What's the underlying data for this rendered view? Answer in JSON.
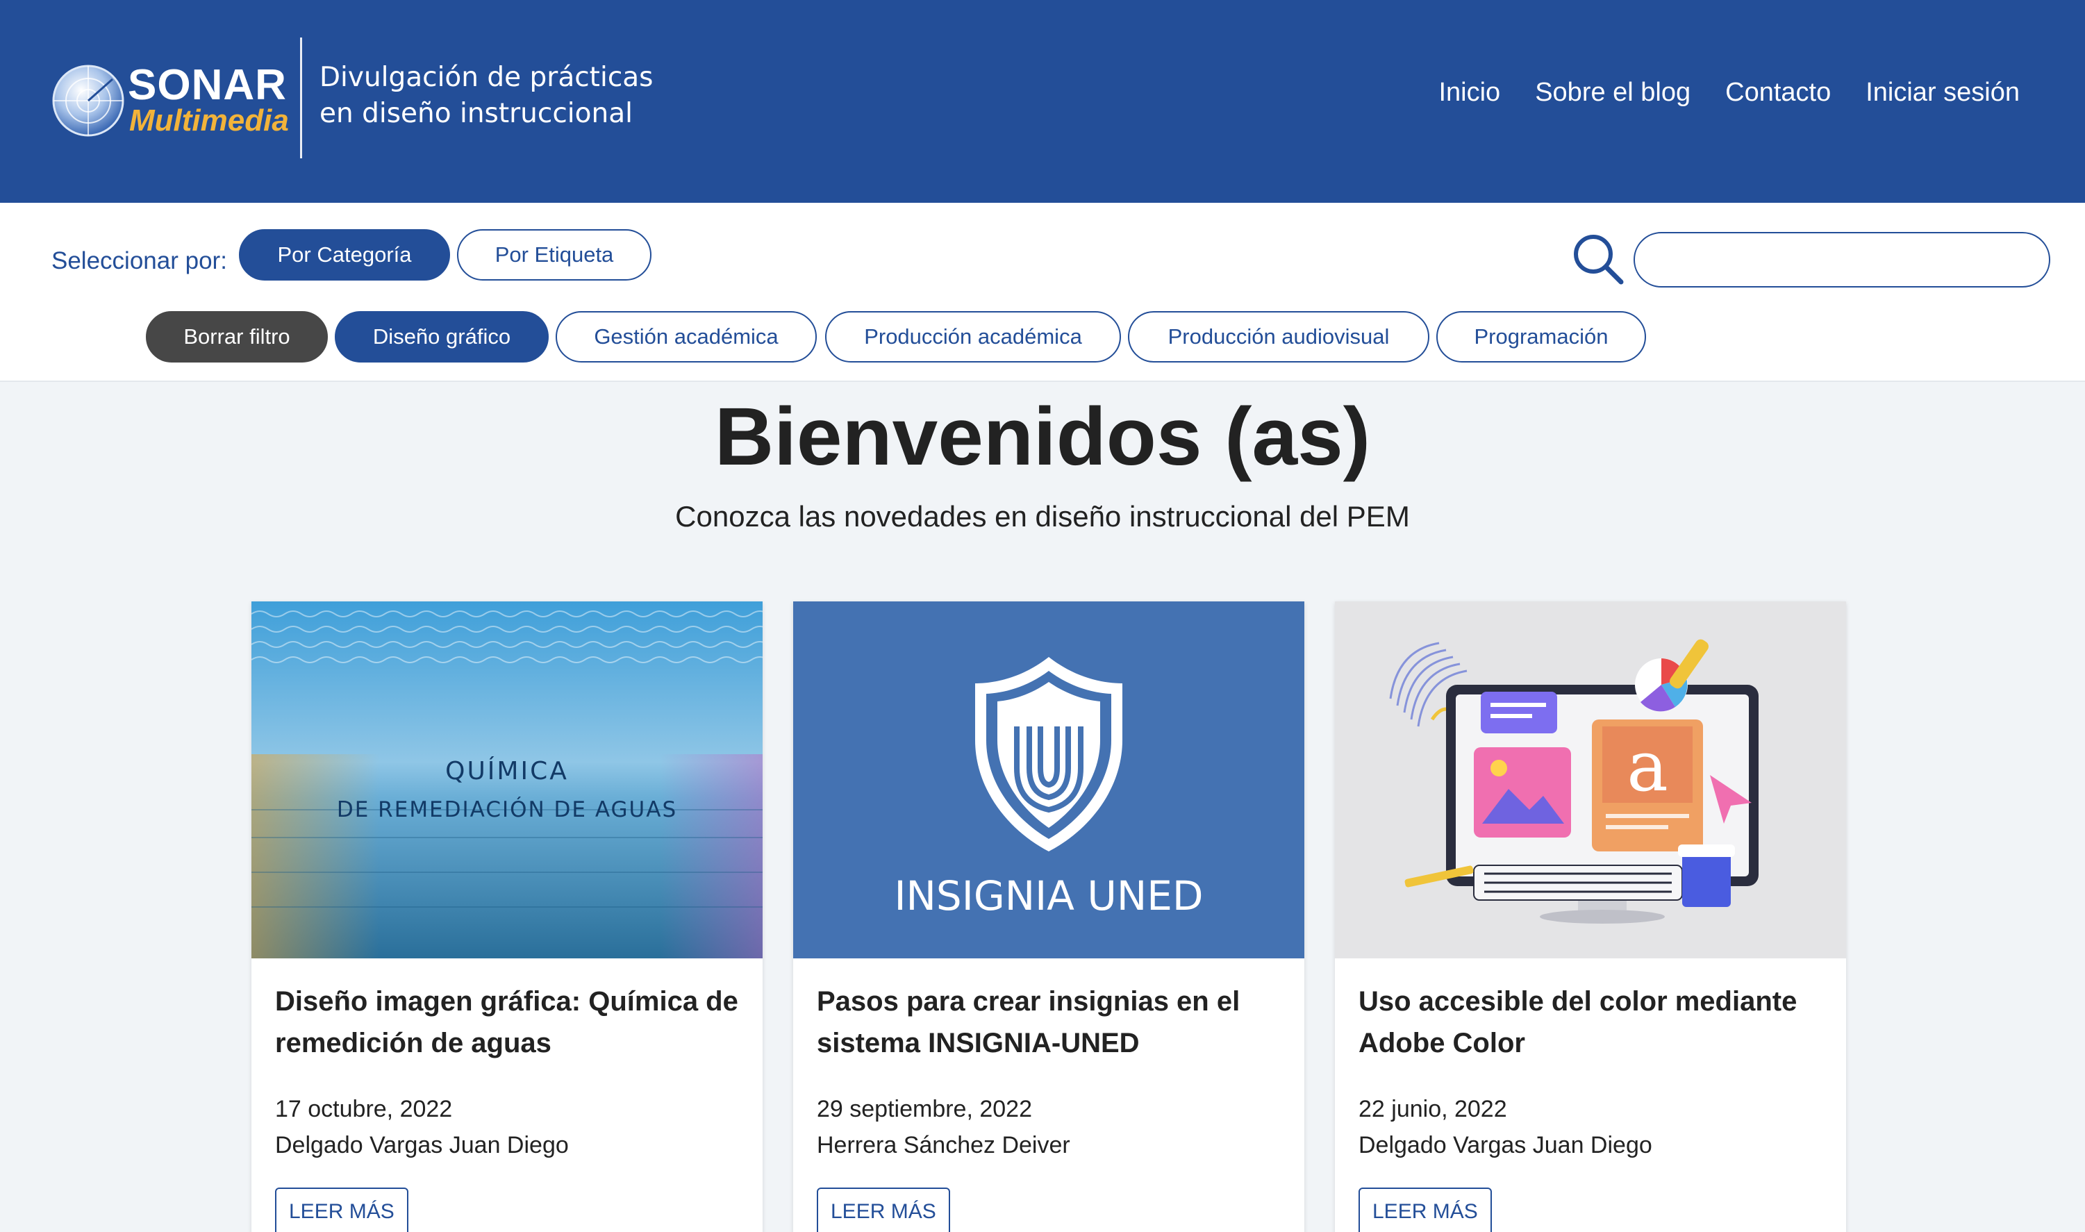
{
  "header": {
    "logo": {
      "name": "SONAR",
      "subname": "Multimedia"
    },
    "tagline_line1": "Divulgación de prácticas",
    "tagline_line2": "en diseño instruccional",
    "nav": [
      {
        "label": "Inicio"
      },
      {
        "label": "Sobre el blog"
      },
      {
        "label": "Contacto"
      },
      {
        "label": "Iniciar sesión"
      }
    ]
  },
  "filters": {
    "select_label": "Seleccionar por:",
    "modes": [
      {
        "label": "Por Categoría",
        "active": true
      },
      {
        "label": "Por Etiqueta",
        "active": false
      }
    ],
    "clear_label": "Borrar filtro",
    "categories": [
      {
        "label": "Diseño gráfico",
        "active": true
      },
      {
        "label": "Gestión académica",
        "active": false
      },
      {
        "label": "Producción académica",
        "active": false
      },
      {
        "label": "Producción audiovisual",
        "active": false
      },
      {
        "label": "Programación",
        "active": false
      }
    ],
    "search": {
      "value": "",
      "placeholder": "",
      "icon": "search-icon"
    }
  },
  "hero": {
    "title": "Bienvenidos (as)",
    "subtitle": "Conozca las novedades en diseño instruccional del PEM"
  },
  "cards": [
    {
      "image_text_line1": "QUÍMICA",
      "image_text_line2": "DE REMEDIACIÓN DE AGUAS",
      "title": "Diseño imagen gráfica: Química de remedición de aguas",
      "date": "17 octubre, 2022",
      "author": "Delgado Vargas Juan Diego",
      "button": "LEER MÁS"
    },
    {
      "image_text_line1": "INSIGNIA UNED",
      "title": "Pasos para crear insignias en el sistema INSIGNIA-UNED",
      "date": "29 septiembre, 2022",
      "author": "Herrera Sánchez Deiver",
      "button": "LEER MÁS"
    },
    {
      "image_text_line1": "a",
      "title": "Uso accesible del color mediante Adobe Color",
      "date": "22 junio, 2022",
      "author": "Delgado Vargas Juan Diego",
      "button": "LEER MÁS"
    }
  ],
  "colors": {
    "brand_blue": "#234e98",
    "logo_gold": "#f2b33a",
    "page_bg": "#f1f4f7",
    "clear_button": "#474747"
  }
}
